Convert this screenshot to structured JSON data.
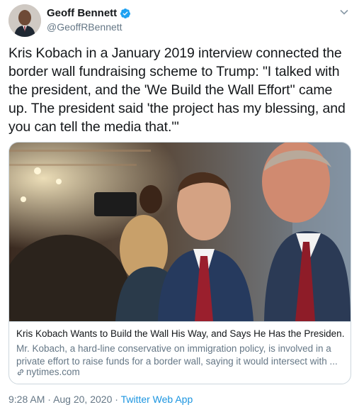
{
  "author": {
    "display_name": "Geoff Bennett",
    "handle": "@GeoffRBennett",
    "verified": true
  },
  "tweet": {
    "text": "Kris Kobach in a January 2019 interview connected the border wall fundraising scheme to Trump: \"I talked with the president, and the 'We Build the Wall Effort'' came up. The president said 'the project has my blessing, and you can tell the media that.'\""
  },
  "card": {
    "title": "Kris Kobach Wants to Build the Wall His Way, and Says He Has the Presiden...",
    "description": "Mr. Kobach, a hard-line conservative on immigration policy, is involved in a private effort to raise funds for a border wall, saying it would intersect with ...",
    "domain": "nytimes.com"
  },
  "meta": {
    "time": "9:28 AM",
    "separator": "·",
    "date": "Aug 20, 2020",
    "source": "Twitter Web App"
  },
  "colors": {
    "accent": "#1da1f2",
    "link": "#1b95e0",
    "secondary_text": "#657786",
    "border": "#ccd6dd"
  },
  "icons": {
    "verified": "verified-badge-icon",
    "caret": "chevron-down-icon",
    "link": "link-icon"
  }
}
